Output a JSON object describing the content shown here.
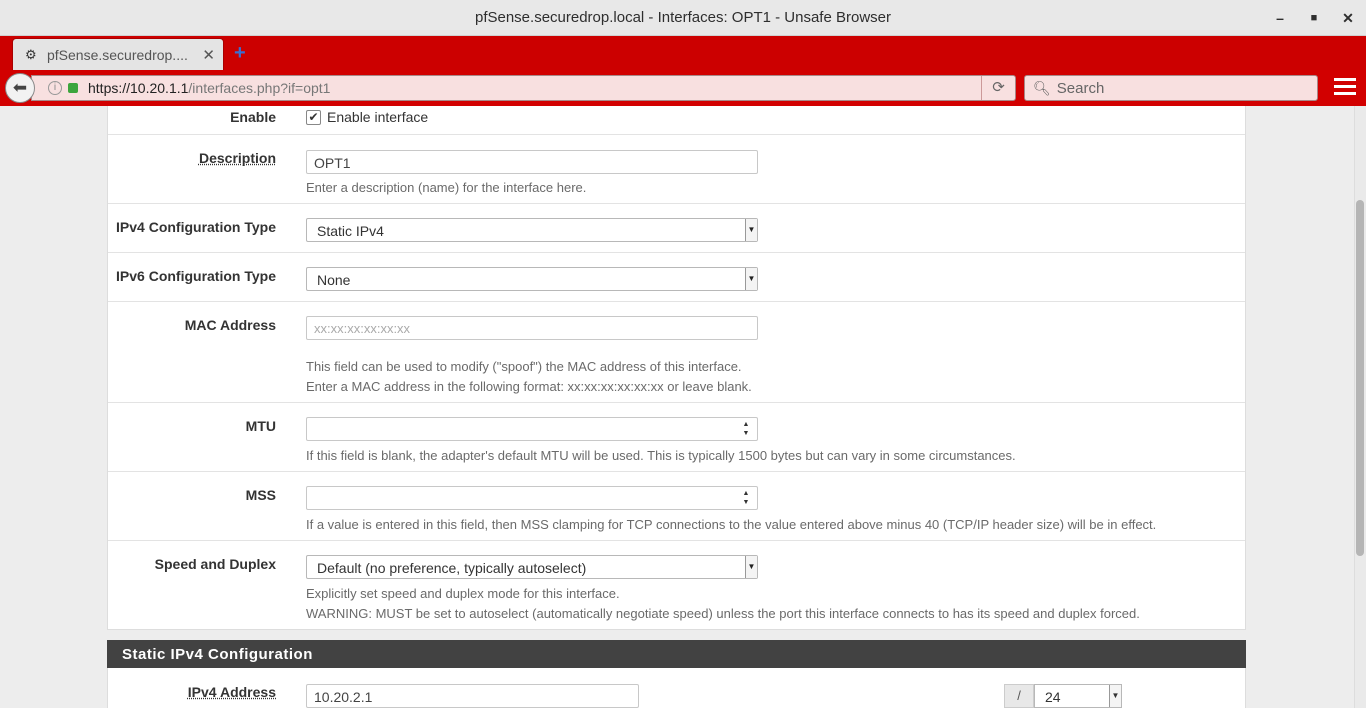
{
  "window": {
    "title": "pfSense.securedrop.local - Interfaces: OPT1 - Unsafe Browser"
  },
  "tab": {
    "label": "pfSense.securedrop...."
  },
  "nav": {
    "url_host": "https://10.20.1.1",
    "url_path": "/interfaces.php?if=opt1",
    "search_placeholder": "Search"
  },
  "form": {
    "enable": {
      "label": "Enable",
      "checkbox_label": "Enable interface",
      "checked": true
    },
    "description": {
      "label": "Description",
      "value": "OPT1",
      "help": "Enter a description (name) for the interface here."
    },
    "ipv4_type": {
      "label": "IPv4 Configuration Type",
      "value": "Static IPv4"
    },
    "ipv6_type": {
      "label": "IPv6 Configuration Type",
      "value": "None"
    },
    "mac": {
      "label": "MAC Address",
      "placeholder": "xx:xx:xx:xx:xx:xx",
      "help1": "This field can be used to modify (\"spoof\") the MAC address of this interface.",
      "help2": "Enter a MAC address in the following format: xx:xx:xx:xx:xx:xx or leave blank."
    },
    "mtu": {
      "label": "MTU",
      "value": "",
      "help": "If this field is blank, the adapter's default MTU will be used. This is typically 1500 bytes but can vary in some circumstances."
    },
    "mss": {
      "label": "MSS",
      "value": "",
      "help": "If a value is entered in this field, then MSS clamping for TCP connections to the value entered above minus 40 (TCP/IP header size) will be in effect."
    },
    "speed": {
      "label": "Speed and Duplex",
      "value": "Default (no preference, typically autoselect)",
      "help1": "Explicitly set speed and duplex mode for this interface.",
      "help2": "WARNING: MUST be set to autoselect (automatically negotiate speed) unless the port this interface connects to has its speed and duplex forced."
    }
  },
  "static_ipv4": {
    "heading": "Static IPv4 Configuration",
    "address_label": "IPv4 Address",
    "address_value": "10.20.2.1",
    "slash": "/",
    "cidr": "24"
  },
  "icons": {
    "minimize": "minimize-icon",
    "maximize": "maximize-icon",
    "close": "close-icon",
    "back": "back-arrow-icon",
    "reload": "reload-icon",
    "search": "search-icon",
    "menu": "hamburger-menu-icon"
  },
  "colors": {
    "tabstrip": "#cc0000",
    "navbar": "#d20000",
    "section_header": "#424242"
  }
}
